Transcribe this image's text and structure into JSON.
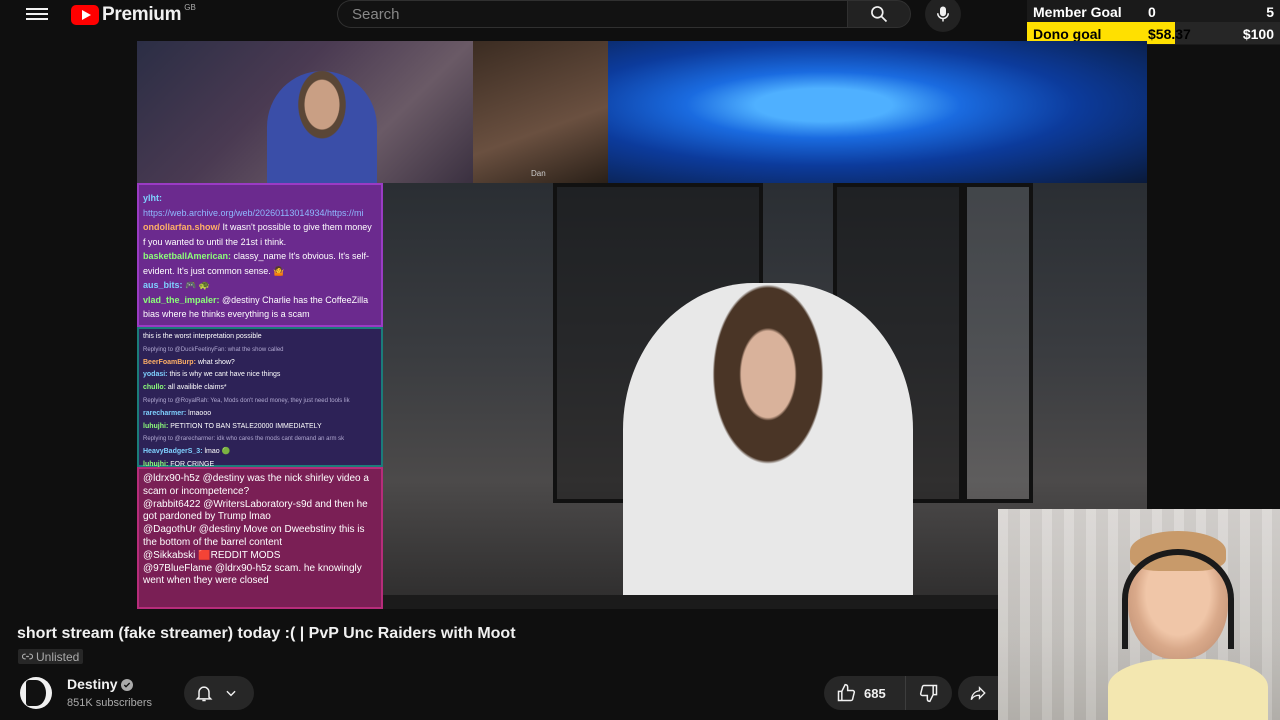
{
  "header": {
    "logo_text": "Premium",
    "country_code": "GB",
    "search_placeholder": "Search"
  },
  "goals": {
    "member": {
      "label": "Member Goal",
      "current": "0",
      "target": "5",
      "progress": 0
    },
    "dono": {
      "label": "Dono goal",
      "current": "$58.37",
      "target": "$100",
      "progress": 0.5837
    },
    "fill_color": "#ffe000"
  },
  "video": {
    "cam_label": "Dan",
    "chat_top": [
      {
        "user": "ylht:",
        "text": ""
      },
      {
        "user": "",
        "link": "https://web.archive.org/web/20260113014934/https://mi"
      },
      {
        "user": "ondollarfan.show/",
        "text": " It wasn't possible to give them money"
      },
      {
        "user": "",
        "text": "f you wanted to until the 21st i think."
      },
      {
        "user": "basketballAmerican:",
        "text": " classy_name It's obvious. It's self-"
      },
      {
        "user": "",
        "text": "evident. It's just common sense. 🤷"
      },
      {
        "user": "aus_bits:",
        "text": " 🎮 🐢"
      },
      {
        "user": "vlad_the_impaler:",
        "text": " @destiny Charlie has the CoffeeZilla"
      },
      {
        "user": "",
        "text": "bias where he thinks everything is a scam"
      }
    ],
    "chat_mid": [
      {
        "user": "",
        "text": "this is the worst interpretation possible"
      },
      {
        "reply": "Replying to @DuckFeetinyFan: what the show called"
      },
      {
        "user": "BeerFoamBurp:",
        "text": " what show?"
      },
      {
        "user": "yodasi:",
        "text": " this is why we cant have nice things"
      },
      {
        "user": "chullo:",
        "text": " all availible claims*"
      },
      {
        "reply": "Replying to @RoyalRah: Yea, Mods don't need money, they just need tools lik"
      },
      {
        "user": "rarecharmer:",
        "text": " lmaooo"
      },
      {
        "user": "luhujhi:",
        "text": " PETITION TO BAN STALE20000 IMMEDIATELY"
      },
      {
        "reply": "Replying to @rarecharmer: idk who cares the mods cant demand an arm sk"
      },
      {
        "user": "HeavyBadgerS_3:",
        "text": " lmao 🟢"
      },
      {
        "user": "luhujhi:",
        "text": " FOR CRINGE"
      }
    ],
    "chat_bottom": [
      {
        "text": "@ldrx90-h5z @destiny was the nick shirley video a scam or incompetence?"
      },
      {
        "text": "@rabbit6422 @WritersLaboratory-s9d and then he got pardoned by Trump lmao"
      },
      {
        "text": "@DagothUr @destiny Move on Dweebstiny this is the bottom of the barrel content"
      },
      {
        "text": "@Sikkabski 🟥REDDIT MODS"
      },
      {
        "text": "@97BlueFlame @ldrx90-h5z scam. he knowingly went when they were closed"
      }
    ]
  },
  "meta": {
    "title": "short stream (fake streamer) today :( | PvP Unc Raiders with Moot",
    "visibility": "Unlisted",
    "channel_name": "Destiny",
    "subscribers": "851K subscribers",
    "likes": "685"
  }
}
